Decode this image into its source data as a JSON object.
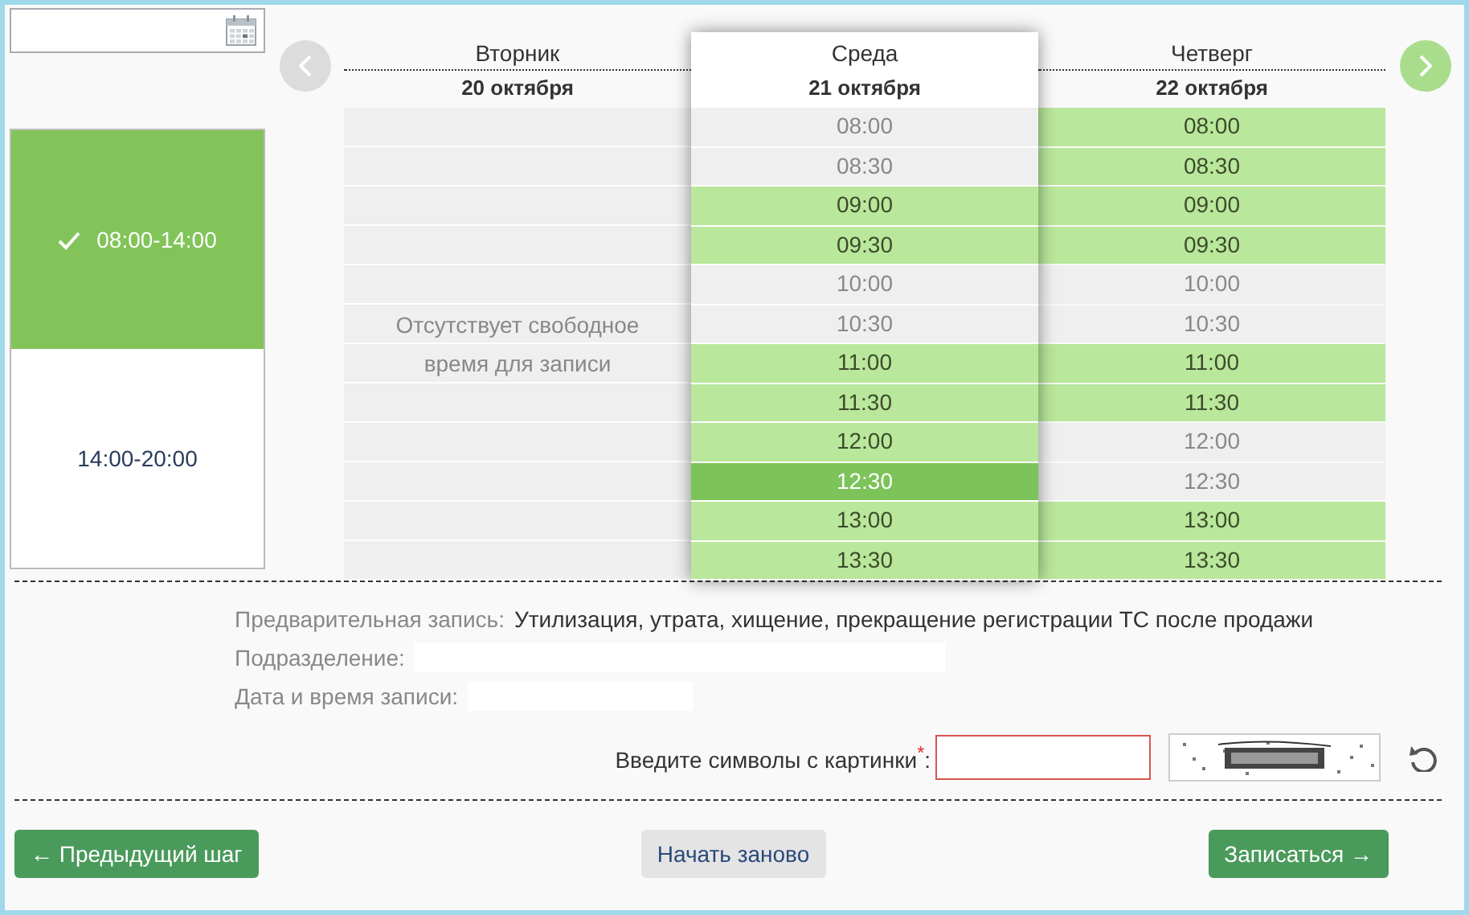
{
  "shifts": [
    {
      "label": "08:00-14:00",
      "selected": true
    },
    {
      "label": "14:00-20:00",
      "selected": false
    }
  ],
  "nav": {
    "prev_enabled": false,
    "next_enabled": true
  },
  "days": [
    {
      "weekday": "Вторник",
      "date": "20 октября",
      "message": "Отсутствует свободное время для записи"
    },
    {
      "weekday": "Среда",
      "date": "21 октября",
      "raised": true,
      "slots": [
        {
          "time": "08:00",
          "available": false,
          "selected": false
        },
        {
          "time": "08:30",
          "available": false,
          "selected": false
        },
        {
          "time": "09:00",
          "available": true,
          "selected": false
        },
        {
          "time": "09:30",
          "available": true,
          "selected": false
        },
        {
          "time": "10:00",
          "available": false,
          "selected": false
        },
        {
          "time": "10:30",
          "available": false,
          "selected": false
        },
        {
          "time": "11:00",
          "available": true,
          "selected": false
        },
        {
          "time": "11:30",
          "available": true,
          "selected": false
        },
        {
          "time": "12:00",
          "available": true,
          "selected": false
        },
        {
          "time": "12:30",
          "available": true,
          "selected": true
        },
        {
          "time": "13:00",
          "available": true,
          "selected": false
        },
        {
          "time": "13:30",
          "available": true,
          "selected": false
        }
      ]
    },
    {
      "weekday": "Четверг",
      "date": "22 октября",
      "slots": [
        {
          "time": "08:00",
          "available": true,
          "selected": false
        },
        {
          "time": "08:30",
          "available": true,
          "selected": false
        },
        {
          "time": "09:00",
          "available": true,
          "selected": false
        },
        {
          "time": "09:30",
          "available": true,
          "selected": false
        },
        {
          "time": "10:00",
          "available": false,
          "selected": false
        },
        {
          "time": "10:30",
          "available": false,
          "selected": false
        },
        {
          "time": "11:00",
          "available": true,
          "selected": false
        },
        {
          "time": "11:30",
          "available": true,
          "selected": false
        },
        {
          "time": "12:00",
          "available": false,
          "selected": false
        },
        {
          "time": "12:30",
          "available": false,
          "selected": false
        },
        {
          "time": "13:00",
          "available": true,
          "selected": false
        },
        {
          "time": "13:30",
          "available": true,
          "selected": false
        }
      ]
    }
  ],
  "summary": [
    {
      "label": "Предварительная запись:",
      "value": "Утилизация, утрата, хищение, прекращение регистрации ТС после продажи"
    },
    {
      "label": "Подразделение:"
    },
    {
      "label": "Дата и время записи:"
    }
  ],
  "captcha": {
    "label": "Введите символы с картинки",
    "required_mark": "*",
    "colon": ":"
  },
  "buttons": {
    "prev": "← Предыдущий шаг",
    "restart": "Начать заново",
    "submit": "Записаться →"
  }
}
